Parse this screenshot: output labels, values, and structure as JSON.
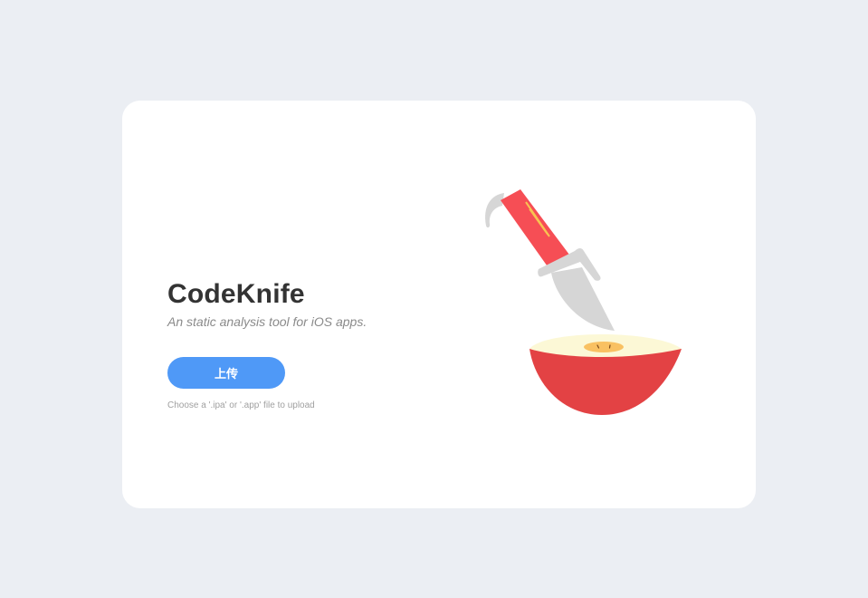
{
  "app": {
    "title": "CodeKnife",
    "subtitle": "An static analysis tool for iOS apps."
  },
  "upload": {
    "button_label": "上传",
    "hint": "Choose a '.ipa' or '.app' file to upload"
  },
  "illustration": {
    "icon": "knife-cutting-apple-illustration",
    "colors": {
      "blade": "#d6d6d6",
      "handle": "#f64e55",
      "handle_stripe": "#f8c451",
      "apple_skin": "#e34244",
      "apple_flesh": "#fcf8d6",
      "apple_core": "#f9c162"
    }
  },
  "colors": {
    "background": "#ebeef3",
    "card": "#ffffff",
    "accent": "#4f99f7"
  }
}
